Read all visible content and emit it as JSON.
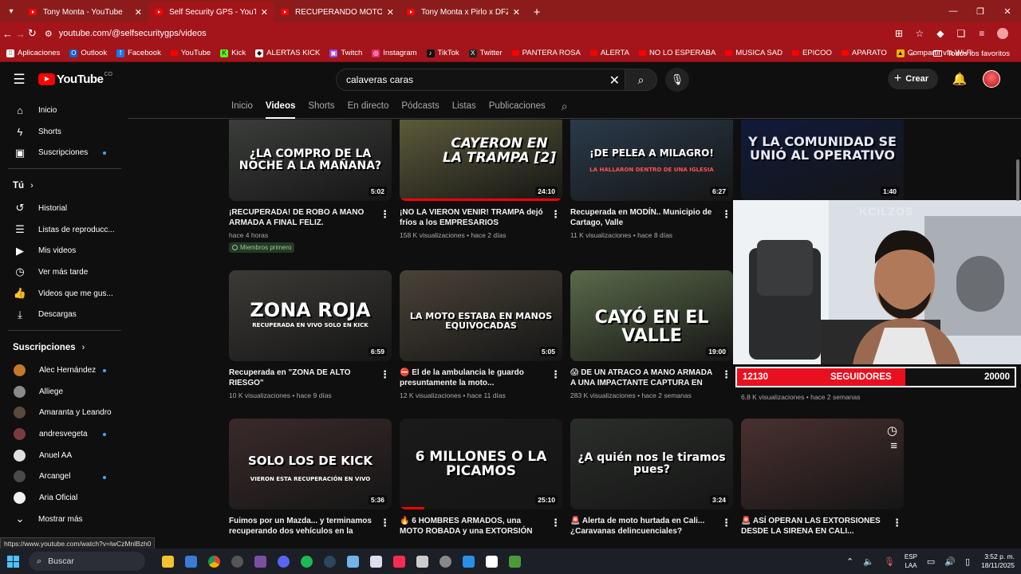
{
  "browser": {
    "tabs": [
      {
        "title": "Tony Monta - YouTube",
        "active": false
      },
      {
        "title": "Self Security GPS - YouTube",
        "active": true
      },
      {
        "title": "RECUPERANDO MOTOS ROBAD",
        "active": false
      },
      {
        "title": "Tony Monta x Pirlo x DFZM x To",
        "active": false
      }
    ],
    "url": "youtube.com/@selfsecuritygps/videos",
    "bookmarks": [
      "Aplicaciones",
      "Outlook",
      "Facebook",
      "YouTube",
      "Kick",
      "ALERTAS KICK",
      "Twitch",
      "Instagram",
      "TikTok",
      "Twitter",
      "PANTERA ROSA",
      "ALERTA",
      "NO LO ESPERABA",
      "MUSICA SAD",
      "EPICOO",
      "APARATO",
      "Compartir vía Wi-Fi"
    ],
    "all_bookmarks": "Todos los favoritos",
    "status_url": "https://www.youtube.com/watch?v=lwCzMnlBzh0"
  },
  "youtube": {
    "logo_text": "YouTube",
    "country_code": "CO",
    "search_value": "calaveras caras",
    "create_label": "Crear"
  },
  "sidebar": {
    "main": [
      "Inicio",
      "Shorts",
      "Suscripciones"
    ],
    "you_header": "Tú",
    "you": [
      "Historial",
      "Listas de reproducc...",
      "Mis videos",
      "Ver más tarde",
      "Videos que me gus...",
      "Descargas"
    ],
    "subs_header": "Suscripciones",
    "subscriptions": [
      {
        "name": "Alec Hernández",
        "dot": true,
        "color": "#c4792a"
      },
      {
        "name": "Alliege",
        "dot": false,
        "color": "#8a8a8a"
      },
      {
        "name": "Amaranta y Leandro",
        "dot": false,
        "color": "#5a4a3a"
      },
      {
        "name": "andresvegeta",
        "dot": true,
        "color": "#7a3b3b"
      },
      {
        "name": "Anuel AA",
        "dot": false,
        "color": "#e0e0e0"
      },
      {
        "name": "Arcangel",
        "dot": true,
        "color": "#4a4a4a"
      },
      {
        "name": "Aria Oficial",
        "dot": false,
        "color": "#f2f2f2"
      }
    ],
    "show_more": "Mostrar más"
  },
  "channel_tabs": [
    "Inicio",
    "Videos",
    "Shorts",
    "En directo",
    "Pódcasts",
    "Listas",
    "Publicaciones"
  ],
  "videos": [
    {
      "thumb_text": "¿LA COMPRO DE LA NOCHE A LA MAÑANA?",
      "duration": "5:02",
      "title": "¡RECUPERADA! DE ROBO A MANO ARMADA A FINAL FELIZ.",
      "views": "",
      "age": "hace 4 horas",
      "badge": "Miembros primero",
      "bg": "#3a3d3a",
      "text_color": "#ffffff",
      "progress": 0
    },
    {
      "thumb_text": "CAYERON EN LA TRAMPA [2]",
      "duration": "24:10",
      "title": "¡NO LA VIERON VENIR! TRAMPA dejó fríos a los EMPRESARIOS DELINCUENCIALES",
      "views": "158 K visualizaciones",
      "age": "hace 2 días",
      "badge": "",
      "bg": "#5c5a3a",
      "text_color": "#ffffff",
      "progress": 1
    },
    {
      "thumb_text": "¡DE PELEA A MILAGRO!",
      "thumb_sub": "LA HALLARON DENTRO DE UNA IGLESIA",
      "duration": "6:27",
      "title": "Recuperada en MODÍN.. Municipio de Cartago, Valle",
      "views": "11 K visualizaciones",
      "age": "hace 8 días",
      "badge": "",
      "bg": "#2a3a4a",
      "text_color": "#ffffff",
      "progress": 0
    },
    {
      "thumb_text": "Y LA COMUNIDAD SE UNIÓ AL OPERATIVO",
      "duration": "1:40",
      "title": "",
      "views": "",
      "age": "",
      "badge": "",
      "bg": "#101a3a",
      "text_color": "#e8e8ff",
      "progress": 0
    },
    {
      "thumb_text": "ZONA ROJA",
      "thumb_sub": "RECUPERADA EN VIVO SOLO EN KICK",
      "duration": "6:59",
      "title": "Recuperada en \"ZONA DE ALTO RIESGO\"",
      "views": "10 K visualizaciones",
      "age": "hace 9 días",
      "badge": "",
      "bg": "#3c3a36",
      "text_color": "#ffffff",
      "progress": 0
    },
    {
      "thumb_text": "LA MOTO ESTABA EN MANOS EQUIVOCADAS",
      "duration": "5:05",
      "title": "⛔ El de la ambulancia le guardo presuntamente la moto...",
      "views": "12 K visualizaciones",
      "age": "hace 11 días",
      "badge": "",
      "bg": "#4a4238",
      "text_color": "#ffffff",
      "progress": 0
    },
    {
      "thumb_text": "CAYÓ EN EL VALLE",
      "duration": "19:00",
      "title": "😱 DE UN ATRACO A MANO ARMADA A UNA IMPACTANTE CAPTURA EN TULUÁ ...",
      "views": "283 K visualizaciones",
      "age": "hace 2 semanas",
      "badge": "",
      "bg": "#5a6a4a",
      "text_color": "#ffffff",
      "progress": 0
    },
    {
      "thumb_text": "",
      "duration": "",
      "title": "",
      "views": "6,8 K visualizaciones",
      "age": "hace 2 semanas",
      "badge": "",
      "bg": "#101010",
      "text_color": "#ffffff",
      "progress": 0
    },
    {
      "thumb_text": "SOLO LOS DE KICK",
      "thumb_sub": "VIERON ESTA RECUPERACIÓN EN VIVO",
      "duration": "5:36",
      "title": "Fuimos por un Mazda... y terminamos recuperando dos vehículos en la misma ca...",
      "views": "10 K visualizaciones",
      "age": "hace 2 semanas",
      "badge": "",
      "bg": "#3a2a2a",
      "text_color": "#ffffff",
      "progress": 0
    },
    {
      "thumb_text": "6 MILLONES O LA PICAMOS",
      "duration": "25:10",
      "title": "🔥 6 HOMBRES ARMADOS, una MOTO ROBADA y una EXTORSIÓN con INHIBIDOR...",
      "views": "235 K visualizaciones",
      "age": "hace 3 semanas",
      "badge": "",
      "bg": "#1a1a1a",
      "text_color": "#ffffff",
      "progress": 0.15
    },
    {
      "thumb_text": "¿A quién nos le tiramos pues?",
      "duration": "3:24",
      "title": "🚨 Alerta de moto hurtada en Cali... ¿Caravanas delincuenciales?",
      "views": "12 K visualizaciones",
      "age": "hace 3 semanas",
      "badge": "",
      "bg": "#2a2e2a",
      "text_color": "#ffffff",
      "progress": 0
    },
    {
      "thumb_text": "",
      "duration": "",
      "title": "🚨 ASÍ OPERAN LAS EXTORSIONES DESDE LA SIRENA EN CALI... IMPACTANTE...",
      "views": "709 K visualizaciones",
      "age": "hace 1 mes",
      "badge": "",
      "bg": "#4a3030",
      "text_color": "#ffffff",
      "progress": 0
    }
  ],
  "overlay": {
    "watermark": "KCILZOS",
    "followers_current": "12130",
    "followers_label": "SEGUIDORES",
    "followers_goal": "20000",
    "goal_fraction": 0.6065
  },
  "taskbar": {
    "search_placeholder": "Buscar",
    "lang_top": "ESP",
    "lang_bottom": "LAA",
    "time": "3:52 p. m.",
    "date": "18/11/2025"
  }
}
